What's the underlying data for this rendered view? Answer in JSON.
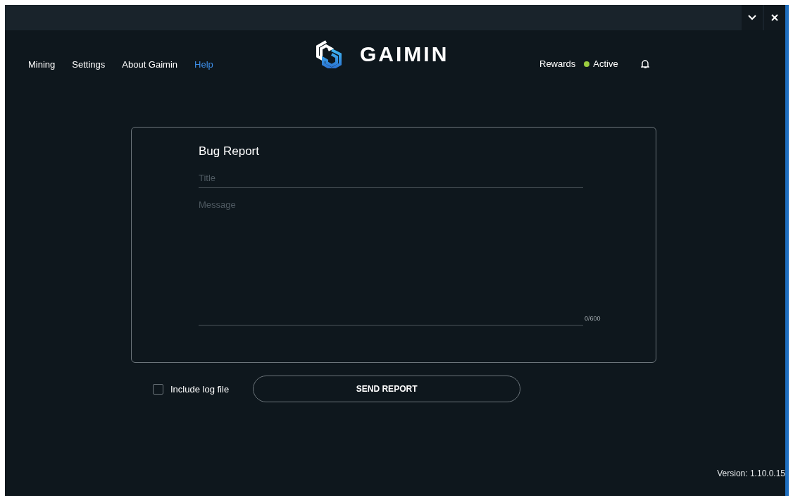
{
  "nav": [
    {
      "label": "Mining",
      "selected": false
    },
    {
      "label": "Settings",
      "selected": false
    },
    {
      "label": "About Gaimin",
      "selected": false
    },
    {
      "label": "Help",
      "selected": true
    }
  ],
  "logo": {
    "text": "GAIMIN"
  },
  "rewards": {
    "label": "Rewards"
  },
  "status": {
    "label": "Active",
    "color": "#9bcc3f"
  },
  "form": {
    "title": "Bug Report",
    "title_field": {
      "placeholder": "Title"
    },
    "message_field": {
      "placeholder": "Message"
    },
    "counter": "0/600"
  },
  "include_log": {
    "label": "Include log file",
    "checked": false
  },
  "send_button": {
    "label": "SEND REPORT"
  },
  "version": "Version: 1.10.0.15"
}
